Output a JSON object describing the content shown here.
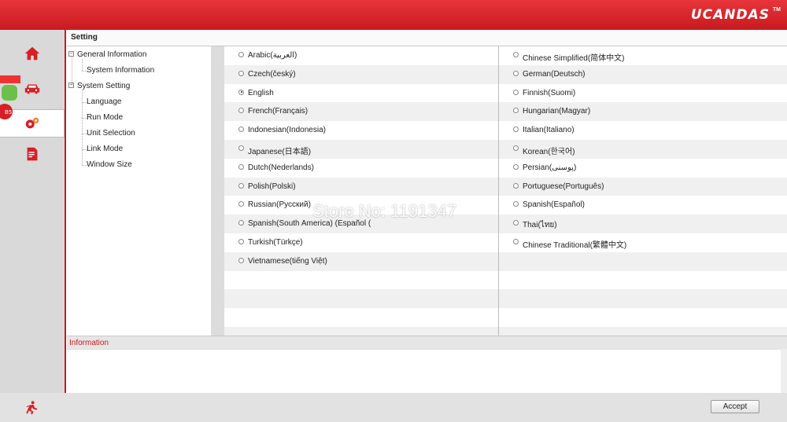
{
  "app": {
    "brand": "UCANDAS",
    "trademark": "TM",
    "accent": "#c81a20"
  },
  "page": {
    "title": "Setting"
  },
  "sidebar": {
    "items": [
      {
        "icon": "home-icon"
      },
      {
        "icon": "car-icon"
      },
      {
        "icon": "gear-icon",
        "active": true
      },
      {
        "icon": "report-icon"
      }
    ],
    "badge_text": "B5"
  },
  "tree": {
    "general": "General Information",
    "system_information": "System Information",
    "system_setting": "System Setting",
    "language": "Language",
    "run_mode": "Run Mode",
    "unit_selection": "Unit Selection",
    "link_mode": "Link Mode",
    "window_size": "Window Size"
  },
  "languages": {
    "left": [
      "Arabic(العربية)",
      "Czech(český)",
      "English",
      "French(Français)",
      "Indonesian(Indonesia)",
      "Japanese(日本語)",
      "Dutch(Nederlands)",
      "Polish(Polski)",
      "Russian(Русский)",
      "Spanish(South America) (Español (",
      "Turkish(Türkçe)",
      "Vietnamese(tiếng Việt)"
    ],
    "right": [
      "Chinese Simplified(简体中文)",
      "German(Deutsch)",
      "Finnish(Suomi)",
      "Hungarian(Magyar)",
      "Italian(Italiano)",
      "Korean(한국어)",
      "Persian(پوسنی)",
      "Portuguese(Português)",
      "Spanish(Español)",
      "Thai(ไทย)",
      "Chinese Traditional(繁體中文)"
    ],
    "selected": "English"
  },
  "info": {
    "header": "Information",
    "body": ""
  },
  "footer": {
    "accept_label": "Accept"
  },
  "watermark": "Store No: 1191347"
}
